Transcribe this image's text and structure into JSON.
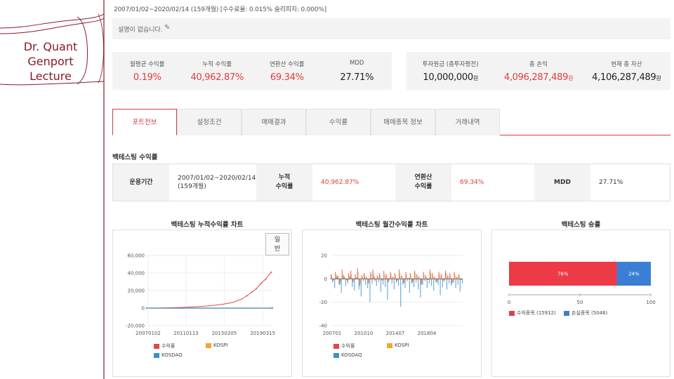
{
  "deco": {
    "title_lines": [
      "Dr. Quant",
      "Genport",
      "Lecture"
    ]
  },
  "header": {
    "period_text": "2007/01/02~2020/02/14 (159개월) [수수료율: 0.015% 슬리피지: 0.000%]",
    "description": "설명이 없습니다."
  },
  "summary_left": [
    {
      "label": "월평균 수익률",
      "value": "0.19%"
    },
    {
      "label": "누적 수익률",
      "value": "40,962.87%"
    },
    {
      "label": "연환산 수익률",
      "value": "69.34%"
    },
    {
      "label": "MDD",
      "value": "27.71%"
    }
  ],
  "summary_right": [
    {
      "label": "투자원금 (총투자평전)",
      "value": "10,000,000",
      "unit": "원"
    },
    {
      "label": "총 손익",
      "value": "4,096,287,489",
      "unit": "원"
    },
    {
      "label": "현재 총 자산",
      "value": "4,106,287,489",
      "unit": "원"
    }
  ],
  "tabs": [
    "포트전보",
    "설정조건",
    "매매결과",
    "수익률",
    "매매종목 정보",
    "거래내역"
  ],
  "section_title": "백테스팅 수익률",
  "stats": {
    "period_label": "운용기간",
    "period_value_1": "2007/01/02~2020/02/14",
    "period_value_2": "(159개월)",
    "cum_label_1": "누적",
    "cum_label_2": "수익률",
    "cum_value": "40,962.87%",
    "ann_label_1": "연환산",
    "ann_label_2": "수익률",
    "ann_value": "69.34%",
    "mdd_label": "MDD",
    "mdd_value": "27.71%"
  },
  "charts": {
    "cumulative_title": "백테스팅 누적수익률 차트",
    "monthly_title": "백테스팅 월간수익률 차트",
    "winrate_title": "백테스팅 승률",
    "zoom_label_1": "일",
    "zoom_label_2": "반",
    "legend_main": [
      "수익률",
      "KOSPI",
      "KOSDAQ"
    ],
    "legend_win": [
      "수익종목 (15912)",
      "손실종목 (5046)"
    ]
  },
  "colors": {
    "accent": "#d33c3c",
    "returns": "#e04747",
    "kospi": "#f0a830",
    "kosdaq": "#3b8fd0",
    "win": "#ec3b46",
    "loss": "#3a7fd5"
  },
  "chart_data": [
    {
      "type": "line",
      "title": "백테스팅 누적수익률 차트",
      "x_ticks": [
        "20070102",
        "20110113",
        "20150205",
        "20190315"
      ],
      "y_ticks": [
        "60,000",
        "40,000",
        "20,000",
        "0",
        "-20,000"
      ],
      "ylim": [
        -20000,
        60000
      ],
      "series": [
        {
          "name": "수익률",
          "x": [
            2007.0,
            2008.0,
            2009.0,
            2010.0,
            2011.0,
            2012.0,
            2013.0,
            2014.0,
            2015.0,
            2016.0,
            2016.5,
            2017.0,
            2017.5,
            2018.0,
            2018.5,
            2019.0,
            2019.5,
            2020.1
          ],
          "values": [
            0,
            100,
            300,
            600,
            1000,
            1500,
            2200,
            3200,
            4500,
            6500,
            8500,
            10500,
            14000,
            18000,
            22000,
            28000,
            33000,
            41000
          ]
        },
        {
          "name": "KOSPI",
          "x": [
            2007.0,
            2020.1
          ],
          "values": [
            0,
            50
          ]
        },
        {
          "name": "KOSDAQ",
          "x": [
            2007.0,
            2020.1
          ],
          "values": [
            0,
            0
          ]
        }
      ],
      "legend": "bottom"
    },
    {
      "type": "bar",
      "title": "백테스팅 월간수익률 차트",
      "x_ticks": [
        "200701",
        "201010",
        "201407",
        "201804"
      ],
      "y_ticks": [
        "20",
        "0",
        "-20",
        "-40"
      ],
      "ylim": [
        -40,
        20
      ],
      "series": [
        {
          "name": "수익률",
          "values": [
            4,
            -2,
            6,
            3,
            -5,
            8,
            2,
            -1,
            5,
            7,
            -3,
            4,
            9,
            -6,
            3,
            5,
            2,
            -4,
            6,
            8,
            -2,
            3,
            5,
            -1,
            7,
            4,
            -3,
            6,
            2,
            5,
            -2,
            8,
            3,
            -4,
            6,
            1,
            5,
            -3,
            7,
            4,
            2,
            -5,
            6,
            3,
            -1,
            8,
            5,
            2,
            -3,
            6,
            4,
            -2,
            7,
            3,
            5,
            -4,
            6,
            2,
            4,
            -1
          ]
        },
        {
          "name": "KOSPI",
          "values": [
            3,
            -1,
            4,
            2,
            -3,
            5,
            1,
            -2,
            3,
            4,
            -2,
            2,
            6,
            -4,
            2,
            3,
            1,
            -3,
            4,
            5,
            -1,
            2,
            3,
            -2,
            4,
            3,
            -2,
            4,
            1,
            3,
            -1,
            5,
            2,
            -3,
            4,
            1,
            3,
            -2,
            5,
            3,
            1,
            -4,
            4,
            2,
            -1,
            5,
            3,
            1,
            -2,
            4,
            3,
            -1,
            5,
            2,
            3,
            -3,
            4,
            1,
            3,
            -1
          ]
        },
        {
          "name": "KOSDAQ",
          "values": [
            -3,
            -8,
            2,
            -5,
            -12,
            3,
            -6,
            -4,
            2,
            -7,
            -10,
            1,
            -9,
            -15,
            -2,
            -5,
            -8,
            -20,
            -4,
            2,
            -6,
            -3,
            -11,
            -5,
            -7,
            -18,
            1,
            -4,
            -9,
            -3,
            -6,
            -24,
            -5,
            -8,
            -2,
            -12,
            -4,
            -7,
            -3,
            -9,
            -16,
            -5,
            -2,
            -8,
            -4,
            -6,
            -10,
            -3,
            -5,
            -14,
            -7,
            -2,
            -9,
            -4,
            -6,
            -3,
            -8,
            -5,
            -11,
            -4
          ]
        }
      ],
      "legend": "bottom"
    },
    {
      "type": "bar",
      "title": "백테스팅 승률",
      "categories": [
        "수익종목",
        "손실종목"
      ],
      "values": [
        76,
        24
      ],
      "counts": [
        15912,
        5046
      ],
      "data_labels": [
        "76%",
        "24%"
      ],
      "x_ticks": [
        "0",
        "50",
        "100"
      ],
      "xlim": [
        0,
        100
      ],
      "stacked": true,
      "legend": "bottom"
    }
  ]
}
